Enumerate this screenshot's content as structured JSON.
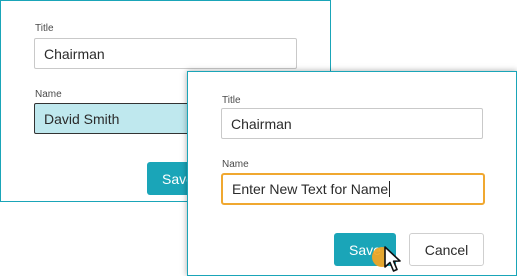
{
  "back_dialog": {
    "title_label": "Title",
    "title_value": "Chairman",
    "name_label": "Name",
    "name_value": "David Smith",
    "save_label": "Save"
  },
  "front_dialog": {
    "title_label": "Title",
    "title_value": "Chairman",
    "name_label": "Name",
    "name_value": "Enter New Text for Name",
    "save_label": "Save",
    "cancel_label": "Cancel"
  },
  "colors": {
    "accent": "#1aa5b8",
    "focus_border": "#f0a830",
    "highlight_fill": "#bfe8ee",
    "click_indicator": "#f5a623"
  },
  "icons": {
    "cursor": "mouse-pointer-icon",
    "click": "click-indicator-icon"
  }
}
